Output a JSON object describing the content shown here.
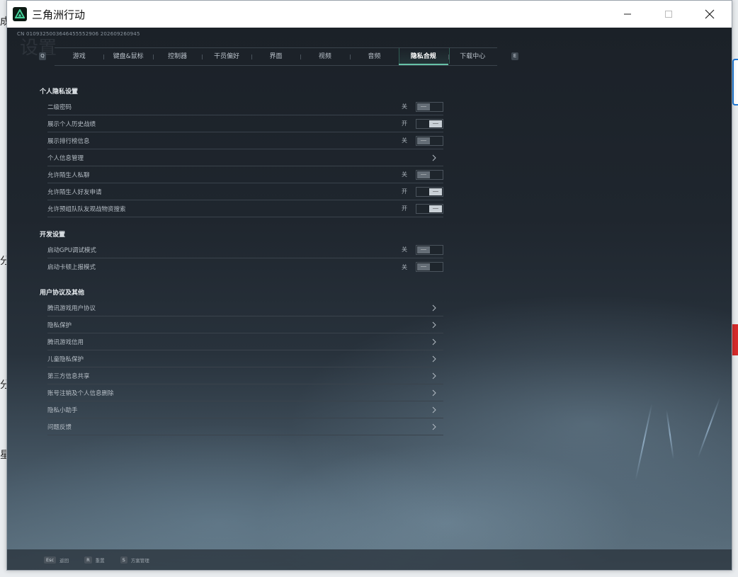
{
  "window": {
    "title": "三角洲行动",
    "build_id": "CN 0109325003646455552906 202609260945",
    "ghost_title": "设置"
  },
  "background_fragments": [
    "成",
    "分",
    "分",
    "星"
  ],
  "tabs": {
    "left_key": "Q",
    "right_key": "E",
    "items": [
      {
        "label": "游戏"
      },
      {
        "label": "键盘&鼠标"
      },
      {
        "label": "控制器"
      },
      {
        "label": "干员偏好"
      },
      {
        "label": "界面"
      },
      {
        "label": "视频"
      },
      {
        "label": "音频"
      },
      {
        "label": "隐私合规"
      },
      {
        "label": "下载中心"
      }
    ],
    "active_index": 7
  },
  "sections": {
    "privacy": {
      "title": "个人隐私设置",
      "rows": [
        {
          "label": "二级密码",
          "state": "关",
          "on": false
        },
        {
          "label": "展示个人历史战绩",
          "state": "开",
          "on": true
        },
        {
          "label": "展示排行榜信息",
          "state": "关",
          "on": false
        },
        {
          "label": "个人信息管理"
        },
        {
          "label": "允许陌生人私聊",
          "state": "关",
          "on": false
        },
        {
          "label": "允许陌生人好友申请",
          "state": "开",
          "on": true
        },
        {
          "label": "允许预组队队友观战物资搜索",
          "state": "开",
          "on": true
        }
      ]
    },
    "developer": {
      "title": "开发设置",
      "rows": [
        {
          "label": "启动GPU调试模式",
          "state": "关",
          "on": false
        },
        {
          "label": "启动卡顿上报模式",
          "state": "关",
          "on": false
        }
      ]
    },
    "agreements": {
      "title": "用户协议及其他",
      "rows": [
        {
          "label": "腾讯游戏用户协议"
        },
        {
          "label": "隐私保护"
        },
        {
          "label": "腾讯游戏信用"
        },
        {
          "label": "儿童隐私保护"
        },
        {
          "label": "第三方信息共享"
        },
        {
          "label": "账号注销及个人信息删除"
        },
        {
          "label": "隐私小助手"
        },
        {
          "label": "问题反馈"
        }
      ]
    }
  },
  "bottom_hints": [
    {
      "key": "Esc",
      "label": "返回"
    },
    {
      "key": "R",
      "label": "重置"
    },
    {
      "key": "S",
      "label": "方案管理"
    }
  ],
  "colors": {
    "accent": "#67c2a8",
    "panel_bg": "#1b2128"
  },
  "icons": {
    "app": "delta-logo-icon",
    "row_arrow": "chevron-right-icon"
  }
}
